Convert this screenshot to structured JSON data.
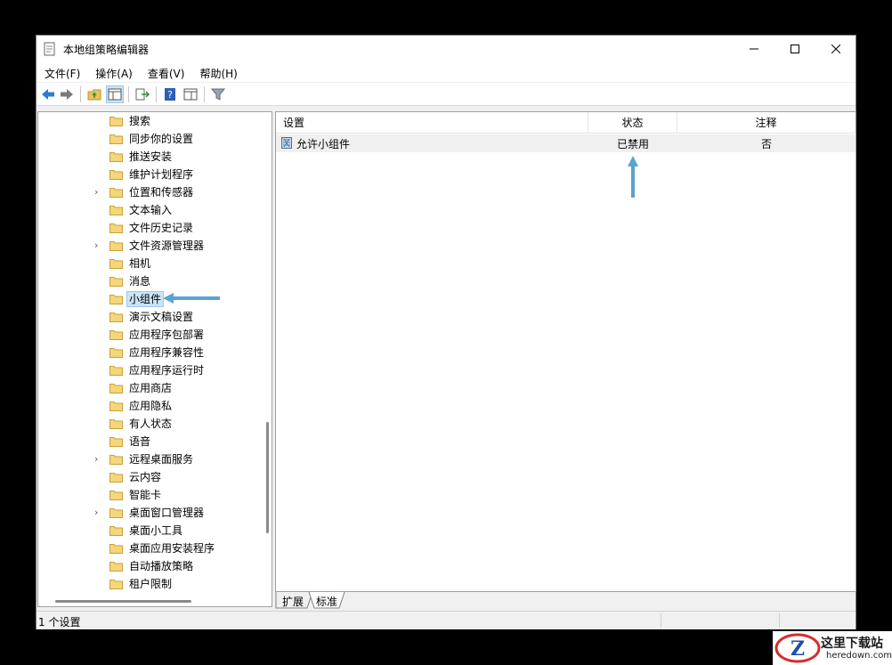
{
  "window": {
    "title": "本地组策略编辑器",
    "controls": [
      "minimize-icon",
      "maximize-icon",
      "close-icon"
    ]
  },
  "menubar": [
    "文件(F)",
    "操作(A)",
    "查看(V)",
    "帮助(H)"
  ],
  "toolbar": [
    "back-arrow-icon",
    "forward-arrow-icon",
    "up-folder-icon",
    "show-hide-tree-icon",
    "export-list-icon",
    "help-icon",
    "properties-pane-icon",
    "filter-icon"
  ],
  "tree": {
    "items": [
      {
        "label": "搜索",
        "expandable": false
      },
      {
        "label": "同步你的设置",
        "expandable": false
      },
      {
        "label": "推送安装",
        "expandable": false
      },
      {
        "label": "维护计划程序",
        "expandable": false
      },
      {
        "label": "位置和传感器",
        "expandable": true
      },
      {
        "label": "文本输入",
        "expandable": false
      },
      {
        "label": "文件历史记录",
        "expandable": false
      },
      {
        "label": "文件资源管理器",
        "expandable": true
      },
      {
        "label": "相机",
        "expandable": false
      },
      {
        "label": "消息",
        "expandable": false
      },
      {
        "label": "小组件",
        "expandable": false,
        "selected": true
      },
      {
        "label": "演示文稿设置",
        "expandable": false
      },
      {
        "label": "应用程序包部署",
        "expandable": false
      },
      {
        "label": "应用程序兼容性",
        "expandable": false
      },
      {
        "label": "应用程序运行时",
        "expandable": false
      },
      {
        "label": "应用商店",
        "expandable": false
      },
      {
        "label": "应用隐私",
        "expandable": false
      },
      {
        "label": "有人状态",
        "expandable": false
      },
      {
        "label": "语音",
        "expandable": false
      },
      {
        "label": "远程桌面服务",
        "expandable": true
      },
      {
        "label": "云内容",
        "expandable": false
      },
      {
        "label": "智能卡",
        "expandable": false
      },
      {
        "label": "桌面窗口管理器",
        "expandable": true
      },
      {
        "label": "桌面小工具",
        "expandable": false
      },
      {
        "label": "桌面应用安装程序",
        "expandable": false
      },
      {
        "label": "自动播放策略",
        "expandable": false
      },
      {
        "label": "租户限制",
        "expandable": false
      }
    ]
  },
  "list": {
    "columns": [
      "设置",
      "状态",
      "注释"
    ],
    "rows": [
      {
        "setting": "允许小组件",
        "state": "已禁用",
        "comment": "否"
      }
    ]
  },
  "tabs": [
    "扩展",
    "标准"
  ],
  "statusbar": {
    "text": "1 个设置"
  },
  "watermark": {
    "title": "这里下载站",
    "url": "heredown.com"
  },
  "colors": {
    "annotation_arrow": "#5ba3d0",
    "selection": "#cce4f7"
  }
}
